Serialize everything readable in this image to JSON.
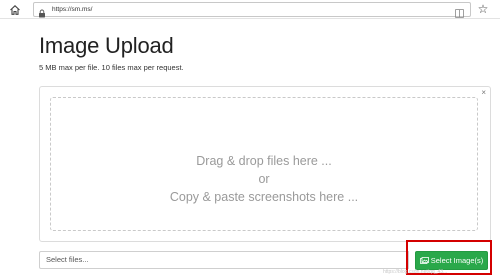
{
  "browser": {
    "url": "https://sm.ms/"
  },
  "page": {
    "title": "Image Upload",
    "subtitle": "5 MB max per file. 10 files max per request."
  },
  "dropzone": {
    "line1": "Drag & drop files here ...",
    "line2": "or",
    "line3": "Copy & paste screenshots here ...",
    "close_glyph": "×"
  },
  "file_input": {
    "placeholder": "Select files..."
  },
  "select_button": {
    "label": "Select Image(s)"
  },
  "watermark": {
    "text": "https://blog.csdn.net/qq_43..."
  },
  "colors": {
    "accent_green": "#2aa84a",
    "highlight_red": "#d40000"
  }
}
